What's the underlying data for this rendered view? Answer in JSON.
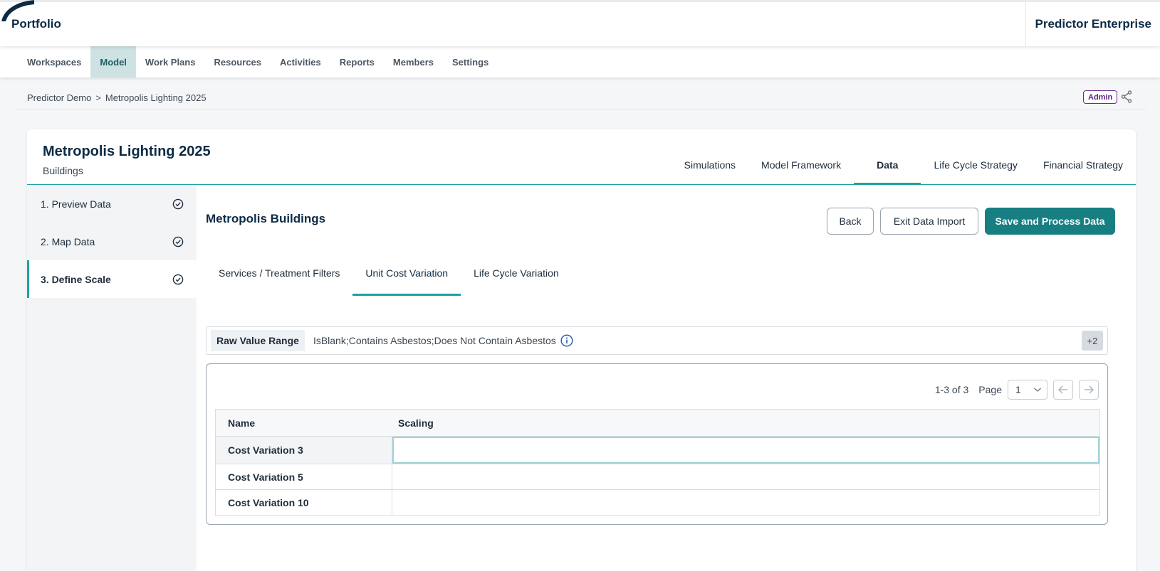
{
  "app": {
    "title": "Portfolio",
    "product": "Predictor Enterprise"
  },
  "main_nav": [
    {
      "label": "Workspaces",
      "active": false
    },
    {
      "label": "Model",
      "active": true
    },
    {
      "label": "Work Plans",
      "active": false
    },
    {
      "label": "Resources",
      "active": false
    },
    {
      "label": "Activities",
      "active": false
    },
    {
      "label": "Reports",
      "active": false
    },
    {
      "label": "Members",
      "active": false
    },
    {
      "label": "Settings",
      "active": false
    }
  ],
  "breadcrumb": {
    "items": [
      "Predictor Demo",
      "Metropolis Lighting 2025"
    ],
    "separator": ">"
  },
  "role_badge": "Admin",
  "model": {
    "title": "Metropolis Lighting 2025",
    "subtitle": "Buildings",
    "tabs": [
      {
        "label": "Simulations",
        "active": false
      },
      {
        "label": "Model Framework",
        "active": false
      },
      {
        "label": "Data",
        "active": true
      },
      {
        "label": "Life Cycle Strategy",
        "active": false
      },
      {
        "label": "Financial Strategy",
        "active": false
      }
    ]
  },
  "steps": [
    {
      "label": "1. Preview Data",
      "done": true,
      "active": false
    },
    {
      "label": "2. Map Data",
      "done": true,
      "active": false
    },
    {
      "label": "3. Define Scale",
      "done": true,
      "active": true
    }
  ],
  "content": {
    "title": "Metropolis Buildings",
    "buttons": {
      "back": "Back",
      "exit": "Exit Data Import",
      "save": "Save and Process Data"
    },
    "sub_tabs": [
      {
        "label": "Services / Treatment Filters",
        "active": false
      },
      {
        "label": "Unit Cost Variation",
        "active": true
      },
      {
        "label": "Life Cycle Variation",
        "active": false
      }
    ],
    "range": {
      "label": "Raw Value Range",
      "value": "IsBlank;Contains Asbestos;Does Not Contain Asbestos",
      "more": "+2"
    },
    "pager": {
      "summary": "1-3 of 3",
      "page_label": "Page",
      "page": "1"
    },
    "table": {
      "columns": [
        "Name",
        "Scaling"
      ],
      "rows": [
        {
          "name": "Cost Variation 3",
          "scaling": ""
        },
        {
          "name": "Cost Variation 5",
          "scaling": ""
        },
        {
          "name": "Cost Variation 10",
          "scaling": ""
        }
      ]
    }
  },
  "colors": {
    "accent": "#1aa3a3",
    "primary_button": "#177f82",
    "navy": "#0d2b45",
    "admin": "#5a1f7c"
  }
}
